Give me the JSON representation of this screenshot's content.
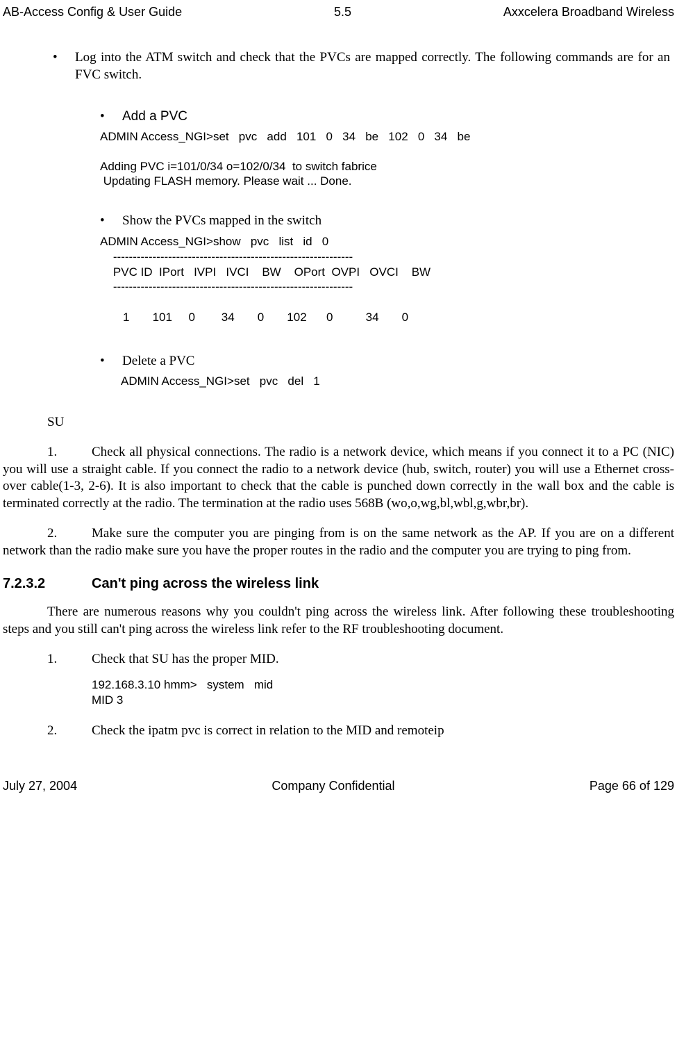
{
  "header": {
    "left": "AB-Access Config & User Guide",
    "center": "5.5",
    "right": "Axxcelera Broadband Wireless"
  },
  "footer": {
    "left": "July 27, 2004",
    "center": "Company Confidential",
    "right": "Page 66 of 129"
  },
  "main_bullet": "Log into the ATM switch and check that the PVCs are mapped correctly. The following commands are for an FVC switch.",
  "add_pvc": {
    "label": "Add a PVC",
    "code": "ADMIN Access_NGI>set   pvc   add   101   0   34   be   102   0   34   be\n\nAdding PVC i=101/0/34 o=102/0/34  to switch fabrice\n Updating FLASH memory. Please wait ... Done."
  },
  "show_pvc": {
    "label": "Show the PVCs mapped in the switch",
    "code": "ADMIN Access_NGI>show   pvc   list   id   0\n    -------------------------------------------------------------\n    PVC ID  IPort   IVPI   IVCI    BW    OPort  OVPI   OVCI    BW\n    -------------------------------------------------------------\n\n       1       101     0        34       0       102      0          34       0"
  },
  "delete_pvc": {
    "label": "Delete a PVC",
    "code": "ADMIN Access_NGI>set   pvc   del   1"
  },
  "su_label": "SU",
  "su_step1_num": "1.",
  "su_step1": "Check all physical connections. The radio is a network device, which means if you connect it to a PC (NIC) you will use a straight cable. If you  connect the radio to a network device (hub, switch, router) you will use a Ethernet cross-over cable(1-3, 2-6). It is also important to check that the cable is punched down correctly in the wall box and the cable is terminated correctly at the radio. The termination at the radio uses 568B (wo,o,wg,bl,wbl,g,wbr,br).",
  "su_step2_num": "2.",
  "su_step2": "Make sure the computer you are pinging from is on the same network as the AP. If you are on a different network than the radio make sure you have the proper routes in the radio and the computer you are trying to ping from.",
  "section": {
    "num": "7.2.3.2",
    "title": "Can't ping across the wireless link"
  },
  "section_intro": "There are numerous reasons why you couldn't ping across the wireless link. After following these troubleshooting steps and you still can't ping across the wireless link refer to the RF troubleshooting document.",
  "wstep1_num": "1.",
  "wstep1": "Check that SU has the proper MID.",
  "wstep1_code": "192.168.3.10 hmm>   system   mid\nMID 3",
  "wstep2_num": "2.",
  "wstep2": "Check the ipatm pvc is correct in relation to the MID and remoteip"
}
